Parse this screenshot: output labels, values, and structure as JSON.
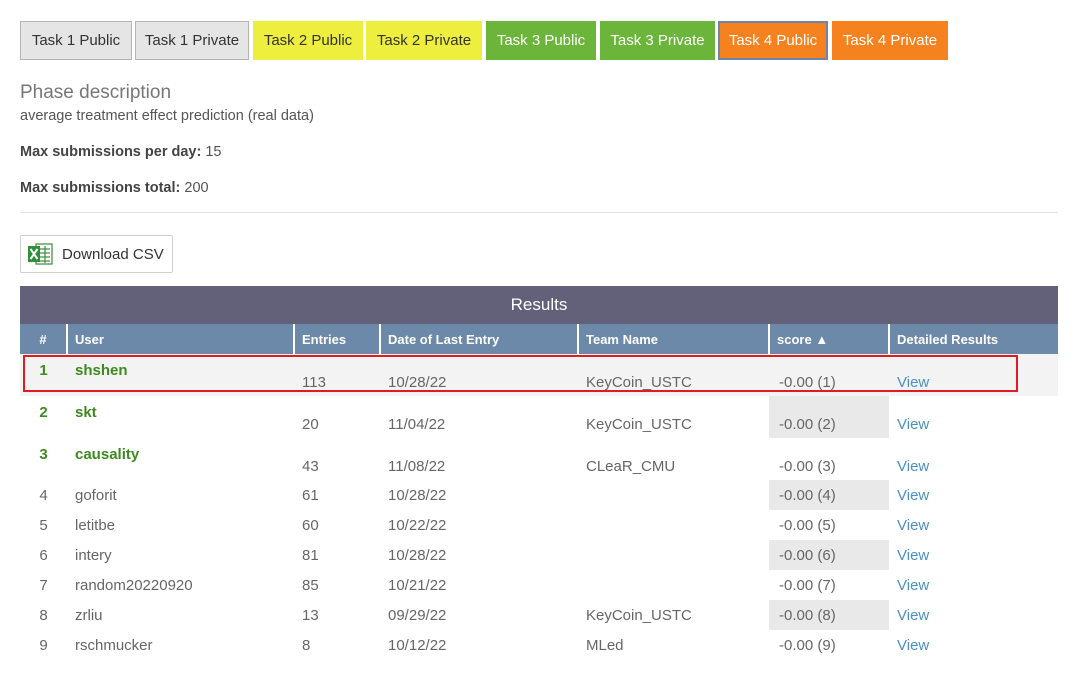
{
  "tabs": [
    {
      "label": "Task 1 Public",
      "style": "grey"
    },
    {
      "label": "Task 1 Private",
      "style": "grey"
    },
    {
      "label": "Task 2 Public",
      "style": "yellow"
    },
    {
      "label": "Task 2 Private",
      "style": "yellow"
    },
    {
      "label": "Task 3 Public",
      "style": "green"
    },
    {
      "label": "Task 3 Private",
      "style": "green"
    },
    {
      "label": "Task 4 Public",
      "style": "orange",
      "active": true
    },
    {
      "label": "Task 4 Private",
      "style": "orange"
    }
  ],
  "phase": {
    "title": "Phase description",
    "subtitle": "average treatment effect prediction (real data)",
    "max_per_day_label": "Max submissions per day:",
    "max_per_day_value": "15",
    "max_total_label": "Max submissions total:",
    "max_total_value": "200"
  },
  "download": {
    "label": "Download CSV",
    "icon": "excel-icon"
  },
  "results": {
    "title": "Results",
    "columns": [
      "#",
      "User",
      "Entries",
      "Date of Last Entry",
      "Team Name",
      "score",
      "Detailed Results"
    ],
    "sort_indicator": "▲",
    "rows": [
      {
        "rank": "1",
        "user": "shshen",
        "entries": "113",
        "date": "10/28/22",
        "team": "KeyCoin_USTC",
        "score": "-0.00 (1)",
        "detail": "View"
      },
      {
        "rank": "2",
        "user": "skt",
        "entries": "20",
        "date": "11/04/22",
        "team": "KeyCoin_USTC",
        "score": "-0.00 (2)",
        "detail": "View"
      },
      {
        "rank": "3",
        "user": "causality",
        "entries": "43",
        "date": "11/08/22",
        "team": "CLeaR_CMU",
        "score": "-0.00 (3)",
        "detail": "View"
      },
      {
        "rank": "4",
        "user": "goforit",
        "entries": "61",
        "date": "10/28/22",
        "team": "",
        "score": "-0.00 (4)",
        "detail": "View"
      },
      {
        "rank": "5",
        "user": "letitbe",
        "entries": "60",
        "date": "10/22/22",
        "team": "",
        "score": "-0.00 (5)",
        "detail": "View"
      },
      {
        "rank": "6",
        "user": "intery",
        "entries": "81",
        "date": "10/28/22",
        "team": "",
        "score": "-0.00 (6)",
        "detail": "View"
      },
      {
        "rank": "7",
        "user": "random20220920",
        "entries": "85",
        "date": "10/21/22",
        "team": "",
        "score": "-0.00 (7)",
        "detail": "View"
      },
      {
        "rank": "8",
        "user": "zrliu",
        "entries": "13",
        "date": "09/29/22",
        "team": "KeyCoin_USTC",
        "score": "-0.00 (8)",
        "detail": "View"
      },
      {
        "rank": "9",
        "user": "rschmucker",
        "entries": "8",
        "date": "10/12/22",
        "team": "MLed",
        "score": "-0.00 (9)",
        "detail": "View"
      }
    ]
  },
  "colors": {
    "results_header": "#626179",
    "column_header": "#6c89a9",
    "top_user_green": "#3d8a20",
    "link_blue": "#4a8fc9",
    "highlight_red": "#e01b22"
  }
}
